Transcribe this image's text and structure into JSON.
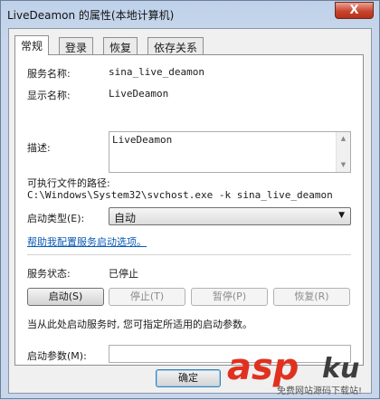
{
  "window": {
    "title": "LiveDeamon 的属性(本地计算机)",
    "close_glyph": "X"
  },
  "tabs": [
    {
      "label": "常规",
      "active": true
    },
    {
      "label": "登录",
      "active": false
    },
    {
      "label": "恢复",
      "active": false
    },
    {
      "label": "依存关系",
      "active": false
    }
  ],
  "general": {
    "service_name_label": "服务名称:",
    "service_name_value": "sina_live_deamon",
    "display_name_label": "显示名称:",
    "display_name_value": "LiveDeamon",
    "description_label": "描述:",
    "description_value": "LiveDeamon",
    "path_label": "可执行文件的路径:",
    "path_value": "C:\\Windows\\System32\\svchost.exe -k sina_live_deamon",
    "startup_type_label": "启动类型(E):",
    "startup_type_value": "自动",
    "help_link": "帮助我配置服务启动选项。",
    "status_label": "服务状态:",
    "status_value": "已停止",
    "buttons": {
      "start": "启动(S)",
      "stop": "停止(T)",
      "pause": "暂停(P)",
      "resume": "恢复(R)"
    },
    "hint": "当从此处启动服务时, 您可指定所适用的启动参数。",
    "start_params_label": "启动参数(M):",
    "start_params_value": ""
  },
  "footer": {
    "ok": "确定"
  },
  "watermark": {
    "brand_a": "asp",
    "brand_b": "ku",
    "tagline": "免费网站源码下载站!"
  },
  "colors": {
    "link": "#0a5ab6",
    "close": "#c9452e",
    "watermark_red": "#e0311f"
  }
}
